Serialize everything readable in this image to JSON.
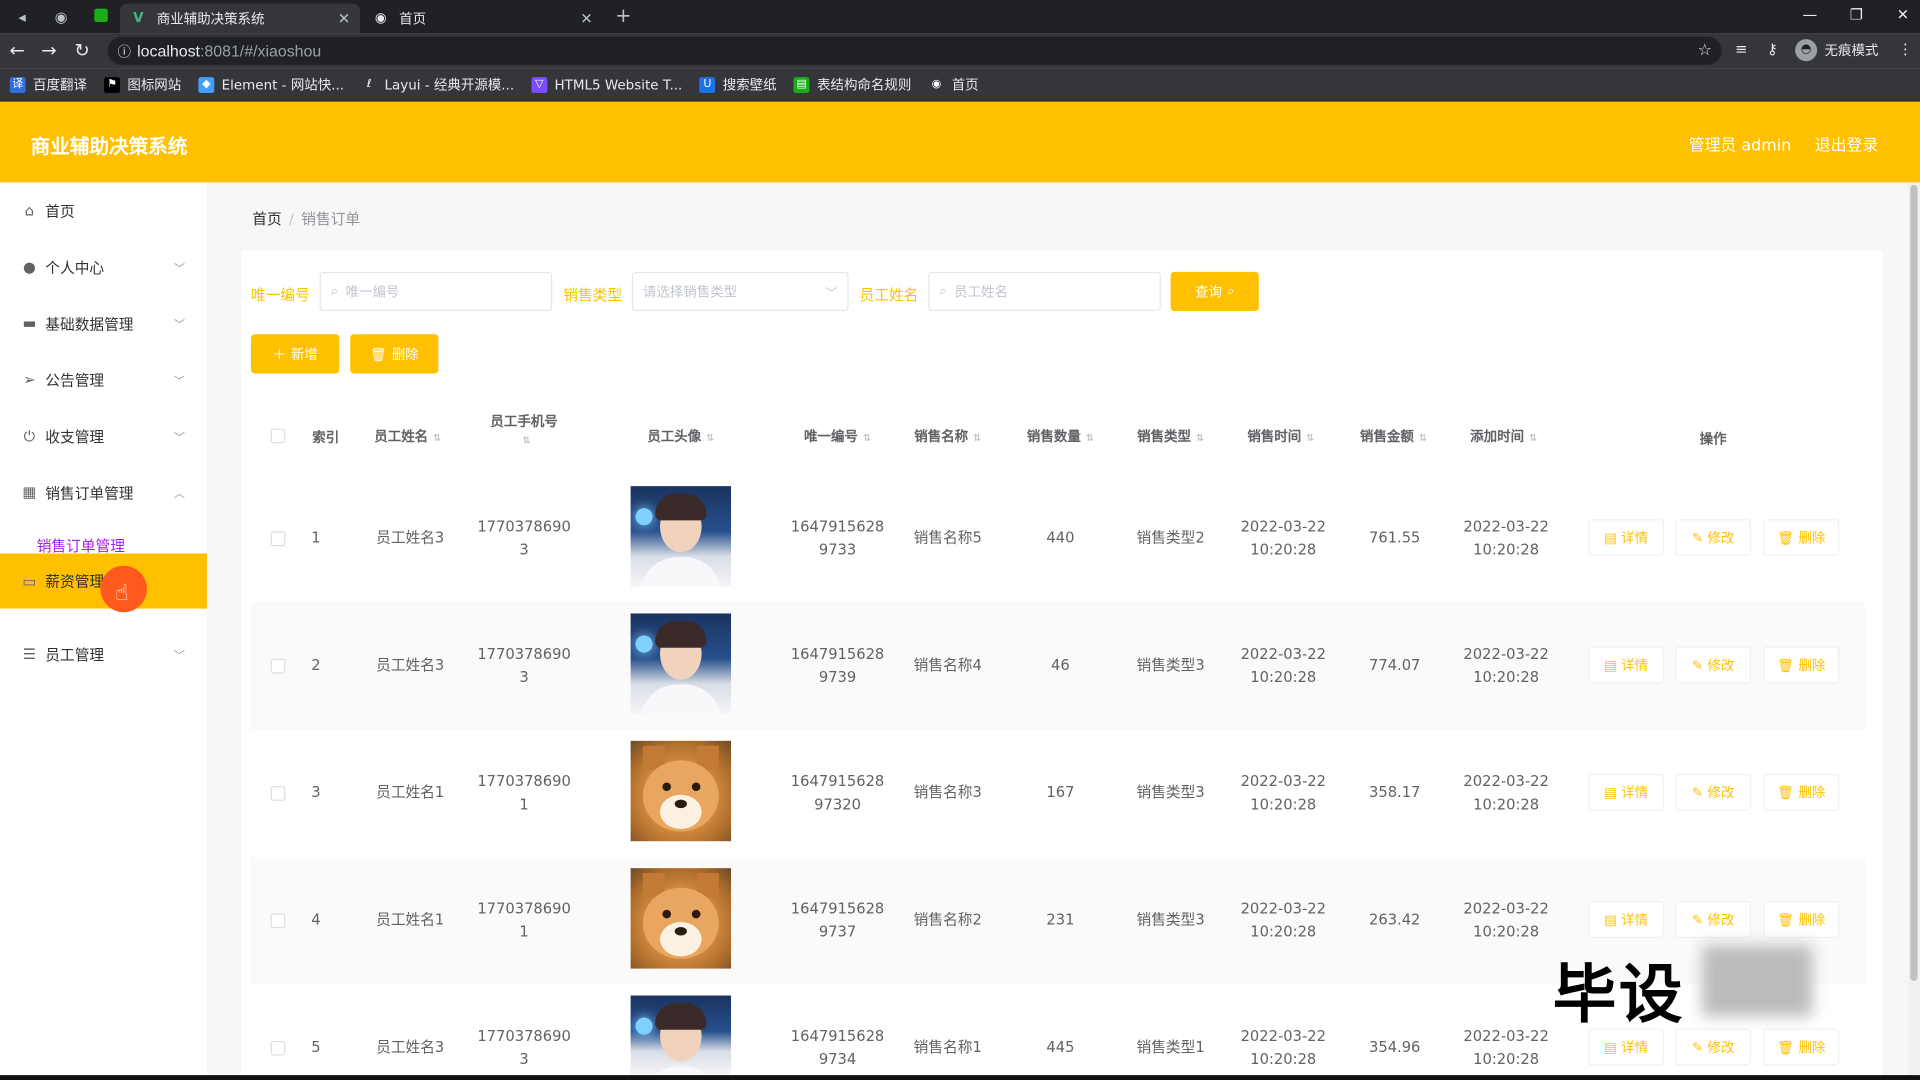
{
  "browser": {
    "tabs": [
      {
        "title": "商业辅助决策系统",
        "active": true
      },
      {
        "title": "首页",
        "active": false
      }
    ],
    "url_host": "localhost",
    "url_rest": ":8081/#/xiaoshou",
    "profile_label": "无痕模式",
    "bookmarks": [
      "百度翻译",
      "图标网站",
      "Element - 网站快...",
      "Layui - 经典开源模...",
      "HTML5 Website T...",
      "搜索壁纸",
      "表结构命名规则",
      "首页"
    ]
  },
  "header": {
    "title": "商业辅助决策系统",
    "user": "管理员 admin",
    "logout": "退出登录",
    "accent_color": "#ffc000"
  },
  "sidebar": {
    "items": [
      {
        "label": "首页",
        "icon": "home-icon"
      },
      {
        "label": "个人中心",
        "icon": "user-icon"
      },
      {
        "label": "基础数据管理",
        "icon": "monitor-icon"
      },
      {
        "label": "公告管理",
        "icon": "send-icon"
      },
      {
        "label": "收支管理",
        "icon": "power-icon"
      },
      {
        "label": "销售订单管理",
        "icon": "grid-icon"
      },
      {
        "label": "薪资管理",
        "icon": "wallet-icon"
      },
      {
        "label": "员工管理",
        "icon": "list-icon"
      }
    ],
    "sub_item": "销售订单管理"
  },
  "breadcrumb": {
    "home": "首页",
    "current": "销售订单"
  },
  "filters": {
    "id_label": "唯一编号",
    "id_placeholder": "唯一编号",
    "type_label": "销售类型",
    "type_placeholder": "请选择销售类型",
    "name_label": "员工姓名",
    "name_placeholder": "员工姓名",
    "query_btn": "查询"
  },
  "actions": {
    "add": "新增",
    "delete": "删除"
  },
  "table": {
    "headers": [
      "索引",
      "员工姓名",
      "员工手机号",
      "员工头像",
      "唯一编号",
      "销售名称",
      "销售数量",
      "销售类型",
      "销售时间",
      "销售金额",
      "添加时间",
      "操作"
    ],
    "op_labels": {
      "detail": "详情",
      "edit": "修改",
      "delete": "删除"
    },
    "rows": [
      {
        "idx": "1",
        "name": "员工姓名3",
        "phone1": "1770378690",
        "phone2": "3",
        "avatar": "person",
        "uid1": "1647915628",
        "uid2": "9733",
        "sale_name": "销售名称5",
        "qty": "440",
        "type": "销售类型2",
        "time1": "2022-03-22",
        "time2": "10:20:28",
        "amount": "761.55",
        "add1": "2022-03-22",
        "add2": "10:20:28"
      },
      {
        "idx": "2",
        "name": "员工姓名3",
        "phone1": "1770378690",
        "phone2": "3",
        "avatar": "person",
        "uid1": "1647915628",
        "uid2": "9739",
        "sale_name": "销售名称4",
        "qty": "46",
        "type": "销售类型3",
        "time1": "2022-03-22",
        "time2": "10:20:28",
        "amount": "774.07",
        "add1": "2022-03-22",
        "add2": "10:20:28"
      },
      {
        "idx": "3",
        "name": "员工姓名1",
        "phone1": "1770378690",
        "phone2": "1",
        "avatar": "dog",
        "uid1": "1647915628",
        "uid2": "97320",
        "sale_name": "销售名称3",
        "qty": "167",
        "type": "销售类型3",
        "time1": "2022-03-22",
        "time2": "10:20:28",
        "amount": "358.17",
        "add1": "2022-03-22",
        "add2": "10:20:28"
      },
      {
        "idx": "4",
        "name": "员工姓名1",
        "phone1": "1770378690",
        "phone2": "1",
        "avatar": "dog",
        "uid1": "1647915628",
        "uid2": "9737",
        "sale_name": "销售名称2",
        "qty": "231",
        "type": "销售类型3",
        "time1": "2022-03-22",
        "time2": "10:20:28",
        "amount": "263.42",
        "add1": "2022-03-22",
        "add2": "10:20:28"
      },
      {
        "idx": "5",
        "name": "员工姓名3",
        "phone1": "1770378690",
        "phone2": "3",
        "avatar": "person",
        "uid1": "1647915628",
        "uid2": "9734",
        "sale_name": "销售名称1",
        "qty": "445",
        "type": "销售类型1",
        "time1": "2022-03-22",
        "time2": "10:20:28",
        "amount": "354.96",
        "add1": "2022-03-22",
        "add2": "10:20:28"
      }
    ]
  },
  "watermark": "毕设"
}
